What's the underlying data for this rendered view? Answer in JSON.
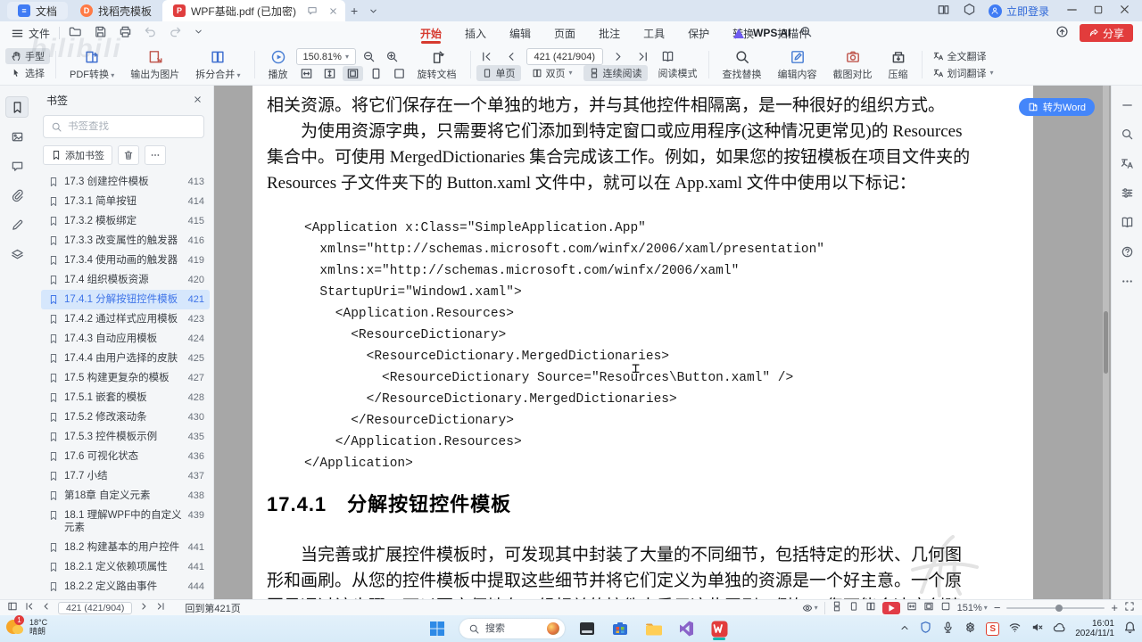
{
  "tabs": {
    "doc": "文档",
    "docer": "找稻壳模板",
    "pdf": "WPF基础.pdf (已加密)"
  },
  "window": {
    "login": "立即登录",
    "share": "分享"
  },
  "quick": {
    "file": "文件"
  },
  "menus": [
    {
      "label": "开始",
      "selected": true
    },
    {
      "label": "插入"
    },
    {
      "label": "编辑"
    },
    {
      "label": "页面"
    },
    {
      "label": "批注"
    },
    {
      "label": "工具"
    },
    {
      "label": "保护"
    },
    {
      "label": "转换"
    },
    {
      "label": "扫描件"
    }
  ],
  "ai": {
    "label": "WPS AI"
  },
  "toolbar": {
    "hand": "手型",
    "select": "选择",
    "pdf_convert": "PDF转换",
    "export_image": "输出为图片",
    "split_merge": "拆分合并",
    "play": "播放",
    "zoom_value": "150.81%",
    "rotate_doc": "旋转文档",
    "page_box": "421 (421/904)",
    "single_page": "单页",
    "double_page": "双页",
    "continuous": "连续阅读",
    "read_mode": "阅读模式",
    "find_replace": "查找替换",
    "edit_content": "编辑内容",
    "shot_compare": "截图对比",
    "compress": "压缩",
    "full_translate": "全文翻译",
    "word_translate": "划词翻译"
  },
  "sidebar": {
    "title": "书签",
    "search_placeholder": "书签查找",
    "add_bookmark": "添加书签",
    "bookmarks": [
      {
        "label": "17.3 创建控件模板",
        "page": "413"
      },
      {
        "label": "17.3.1 简单按钮",
        "page": "414"
      },
      {
        "label": "17.3.2 模板绑定",
        "page": "415"
      },
      {
        "label": "17.3.3 改变属性的触发器",
        "page": "416"
      },
      {
        "label": "17.3.4 使用动画的触发器",
        "page": "419"
      },
      {
        "label": "17.4 组织模板资源",
        "page": "420"
      },
      {
        "label": "17.4.1 分解按钮控件模板",
        "page": "421",
        "selected": true
      },
      {
        "label": "17.4.2 通过样式应用模板",
        "page": "423"
      },
      {
        "label": "17.4.3 自动应用模板",
        "page": "424"
      },
      {
        "label": "17.4.4 由用户选择的皮肤",
        "page": "425"
      },
      {
        "label": "17.5 构建更复杂的模板",
        "page": "427"
      },
      {
        "label": "17.5.1 嵌套的模板",
        "page": "428"
      },
      {
        "label": "17.5.2 修改滚动条",
        "page": "430"
      },
      {
        "label": "17.5.3 控件模板示例",
        "page": "435"
      },
      {
        "label": "17.6 可视化状态",
        "page": "436"
      },
      {
        "label": "17.7 小结",
        "page": "437"
      },
      {
        "label": "第18章 自定义元素",
        "page": "438"
      },
      {
        "label": "18.1 理解WPF中的自定义元素",
        "page": "439"
      },
      {
        "label": "18.2 构建基本的用户控件",
        "page": "441"
      },
      {
        "label": "18.2.1 定义依赖项属性",
        "page": "441"
      },
      {
        "label": "18.2.2 定义路由事件",
        "page": "444"
      }
    ]
  },
  "doc": {
    "convert_word": "转为Word",
    "para_top": [
      "相关资源。将它们保存在一个单独的地方，并与其他控件相隔离，是一种很好的组织方式。",
      "　　为使用资源字典，只需要将它们添加到特定窗口或应用程序(这种情况更常见)的 Resources",
      "集合中。可使用 MergedDictionaries 集合完成该工作。例如，如果您的按钮模板在项目文件夹的",
      "Resources 子文件夹下的 Button.xaml 文件中，就可以在 App.xaml 文件中使用以下标记："
    ],
    "code_lines": [
      "<Application x:Class=\"SimpleApplication.App\"",
      "  xmlns=\"http://schemas.microsoft.com/winfx/2006/xaml/presentation\"",
      "  xmlns:x=\"http://schemas.microsoft.com/winfx/2006/xaml\"",
      "  StartupUri=\"Window1.xaml\">",
      "    <Application.Resources>",
      "      <ResourceDictionary>",
      "        <ResourceDictionary.MergedDictionaries>",
      "          <ResourceDictionary Source=\"Resources\\Button.xaml\" />",
      "        </ResourceDictionary.MergedDictionaries>",
      "      </ResourceDictionary>",
      "    </Application.Resources>",
      "</Application>"
    ],
    "heading": "17.4.1　分解按钮控件模板",
    "para_bottom": [
      "　　当完善或扩展控件模板时，可发现其中封装了大量的不同细节，包括特定的形状、几何图",
      "形和画刷。从您的控件模板中提取这些细节并将它们定义为单独的资源是一个好主意。一个原",
      "因是通过该步骤，可以更方便地在一组相关的控件中重用这些画刷。例如，您可能会决定创建"
    ]
  },
  "status": {
    "page_box": "421 (421/904)",
    "back_link": "回到第421页",
    "zoom": "151%"
  },
  "task": {
    "temp": "18°C",
    "weather": "晴朗",
    "badge": "1",
    "search_placeholder": "搜索",
    "time": "16:01",
    "date": "2024/11/1"
  },
  "watermark": "bilibili"
}
